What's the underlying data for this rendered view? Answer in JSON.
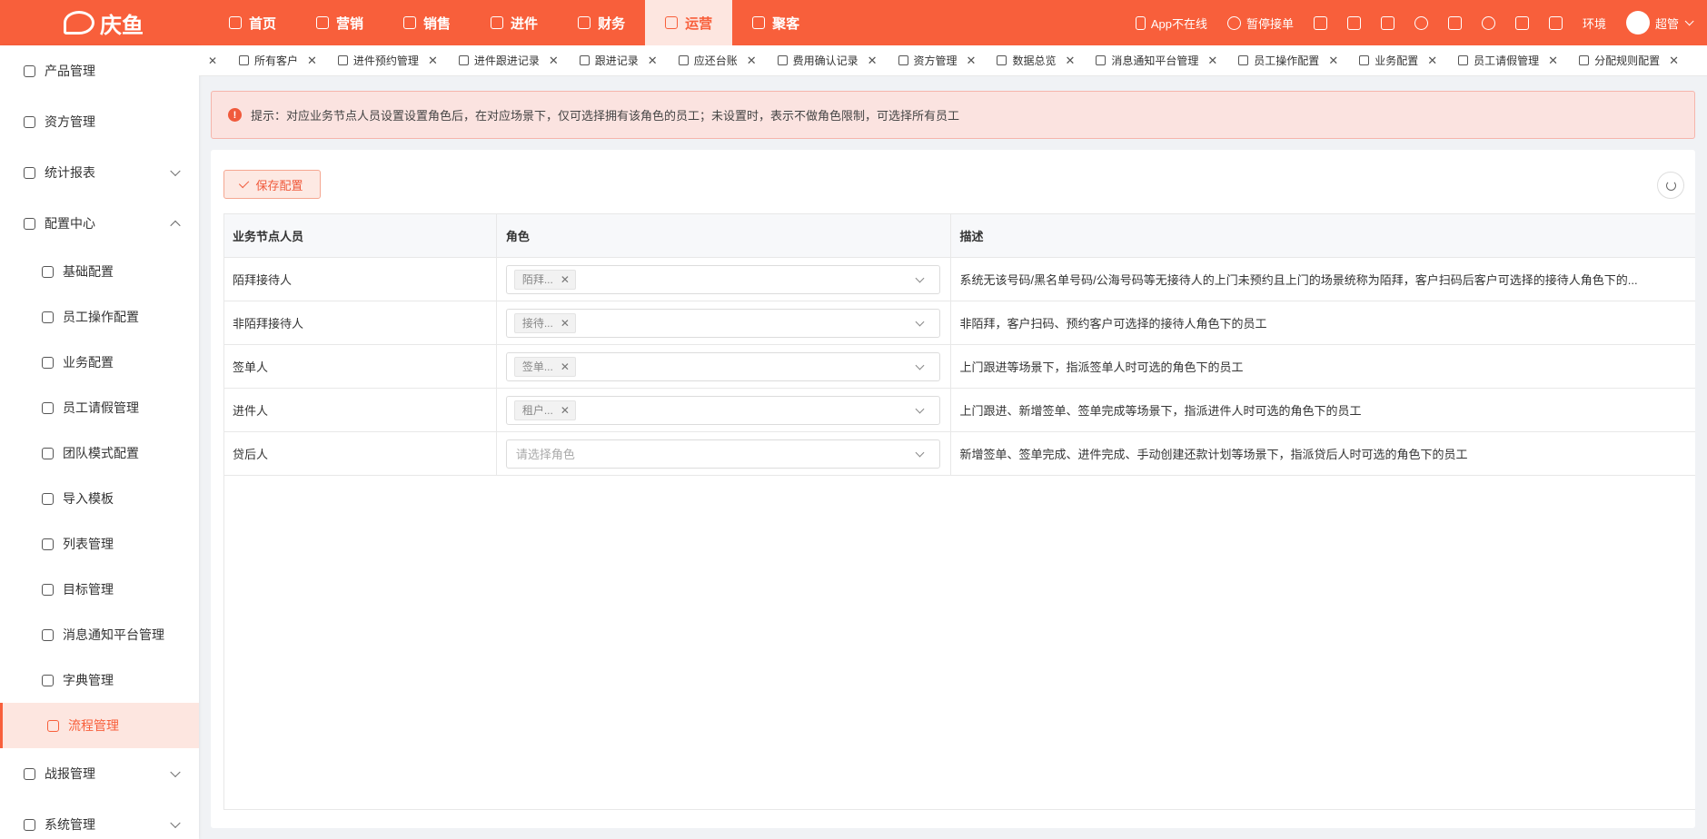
{
  "brand": {
    "name": "庆鱼"
  },
  "topnav": [
    {
      "label": "首页",
      "icon": "home-icon",
      "active": false
    },
    {
      "label": "营销",
      "icon": "marketing-icon",
      "active": false
    },
    {
      "label": "销售",
      "icon": "sales-icon",
      "active": false
    },
    {
      "label": "进件",
      "icon": "document-icon",
      "active": false
    },
    {
      "label": "财务",
      "icon": "finance-icon",
      "active": false
    },
    {
      "label": "运营",
      "icon": "monitor-icon",
      "active": true
    },
    {
      "label": "聚客",
      "icon": "users-icon",
      "active": false
    }
  ],
  "top_right": {
    "app_status": "App不在线",
    "pause_orders": "暂停接单",
    "env_label": "环境",
    "user_name": "超管"
  },
  "sidebar": {
    "items": [
      {
        "label": "产品管理",
        "icon": "layers-icon"
      },
      {
        "label": "资方管理",
        "icon": "bank-icon"
      },
      {
        "label": "统计报表",
        "icon": "chart-icon",
        "expand": "down"
      },
      {
        "label": "配置中心",
        "icon": "gear-icon",
        "expand": "up"
      }
    ],
    "config_children": [
      {
        "label": "基础配置",
        "icon": "cube-icon"
      },
      {
        "label": "员工操作配置",
        "icon": "user-edit-icon"
      },
      {
        "label": "业务配置",
        "icon": "briefcase-icon"
      },
      {
        "label": "员工请假管理",
        "icon": "calendar-icon"
      },
      {
        "label": "团队模式配置",
        "icon": "team-icon"
      },
      {
        "label": "导入模板",
        "icon": "import-icon"
      },
      {
        "label": "列表管理",
        "icon": "list-icon"
      },
      {
        "label": "目标管理",
        "icon": "target-icon"
      },
      {
        "label": "消息通知平台管理",
        "icon": "bell-icon"
      },
      {
        "label": "字典管理",
        "icon": "dictionary-icon"
      },
      {
        "label": "流程管理",
        "icon": "flow-icon",
        "active": true
      }
    ],
    "bottom_items": [
      {
        "label": "战报管理",
        "icon": "report-icon",
        "expand": "down"
      },
      {
        "label": "系统管理",
        "icon": "settings-icon",
        "expand": "down"
      }
    ]
  },
  "tabs": [
    {
      "label": "所有客户",
      "icon": "user-icon"
    },
    {
      "label": "进件预约管理",
      "icon": "user-clock-icon"
    },
    {
      "label": "进件跟进记录",
      "icon": "doc-icon"
    },
    {
      "label": "跟进记录",
      "icon": "doc-icon"
    },
    {
      "label": "应还台账",
      "icon": "card-icon"
    },
    {
      "label": "费用确认记录",
      "icon": "gavel-icon"
    },
    {
      "label": "资方管理",
      "icon": "bank-icon"
    },
    {
      "label": "数据总览",
      "icon": "dashboard-icon"
    },
    {
      "label": "消息通知平台管理",
      "icon": "bell-icon"
    },
    {
      "label": "员工操作配置",
      "icon": "user-edit-icon"
    },
    {
      "label": "业务配置",
      "icon": "briefcase-icon"
    },
    {
      "label": "员工请假管理",
      "icon": "calendar-icon"
    },
    {
      "label": "分配规则配置",
      "icon": "user-icon"
    }
  ],
  "alert": {
    "text": "提示：对应业务节点人员设置设置角色后，在对应场景下，仅可选择拥有该角色的员工；未设置时，表示不做角色限制，可选择所有员工"
  },
  "toolbar": {
    "save_label": "保存配置"
  },
  "table": {
    "headers": [
      "业务节点人员",
      "角色",
      "描述"
    ],
    "rows": [
      {
        "node": "陌拜接待人",
        "role_tag": "陌拜...",
        "role_placeholder": "",
        "desc": "系统无该号码/黑名单号码/公海号码等无接待人的上门未预约且上门的场景统称为陌拜，客户扫码后客户可选择的接待人角色下的..."
      },
      {
        "node": "非陌拜接待人",
        "role_tag": "接待...",
        "role_placeholder": "",
        "desc": "非陌拜，客户扫码、预约客户可选择的接待人角色下的员工"
      },
      {
        "node": "签单人",
        "role_tag": "签单...",
        "role_placeholder": "",
        "desc": "上门跟进等场景下，指派签单人时可选的角色下的员工"
      },
      {
        "node": "进件人",
        "role_tag": "租户...",
        "role_placeholder": "",
        "desc": "上门跟进、新增签单、签单完成等场景下，指派进件人时可选的角色下的员工"
      },
      {
        "node": "贷后人",
        "role_tag": "",
        "role_placeholder": "请选择角色",
        "desc": "新增签单、签单完成、进件完成、手动创建还款计划等场景下，指派贷后人时可选的角色下的员工"
      }
    ]
  },
  "colors": {
    "brand": "#f85f3b",
    "active_bg": "#fde6e0"
  }
}
